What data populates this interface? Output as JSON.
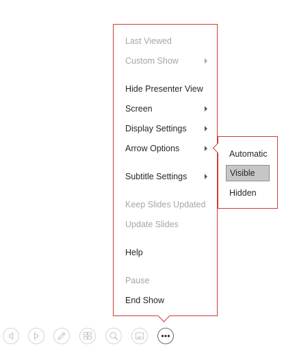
{
  "main_menu": {
    "items": [
      {
        "label": "Last Viewed",
        "enabled": false,
        "has_submenu": false
      },
      {
        "label": "Custom Show",
        "enabled": false,
        "has_submenu": true
      },
      {
        "label": "Hide Presenter View",
        "enabled": true,
        "has_submenu": false
      },
      {
        "label": "Screen",
        "enabled": true,
        "has_submenu": true
      },
      {
        "label": "Display Settings",
        "enabled": true,
        "has_submenu": true
      },
      {
        "label": "Arrow Options",
        "enabled": true,
        "has_submenu": true
      },
      {
        "label": "Subtitle Settings",
        "enabled": true,
        "has_submenu": true
      },
      {
        "label": "Keep Slides Updated",
        "enabled": false,
        "has_submenu": false
      },
      {
        "label": "Update Slides",
        "enabled": false,
        "has_submenu": false
      },
      {
        "label": "Help",
        "enabled": true,
        "has_submenu": false
      },
      {
        "label": "Pause",
        "enabled": false,
        "has_submenu": false
      },
      {
        "label": "End Show",
        "enabled": true,
        "has_submenu": false
      }
    ]
  },
  "arrow_options_submenu": {
    "items": [
      {
        "label": "Automatic",
        "selected": false
      },
      {
        "label": "Visible",
        "selected": true
      },
      {
        "label": "Hidden",
        "selected": false
      }
    ]
  },
  "toolbar": {
    "buttons": [
      {
        "icon": "previous-icon"
      },
      {
        "icon": "next-icon"
      },
      {
        "icon": "pen-icon"
      },
      {
        "icon": "see-all-slides-icon"
      },
      {
        "icon": "zoom-icon"
      },
      {
        "icon": "subtitles-icon"
      },
      {
        "icon": "more-options-icon",
        "active": true
      }
    ]
  },
  "colors": {
    "menu_border": "#d03a31",
    "text": "#262626",
    "disabled_text": "#a6a6a6",
    "selected_bg": "#c6c6c6"
  }
}
